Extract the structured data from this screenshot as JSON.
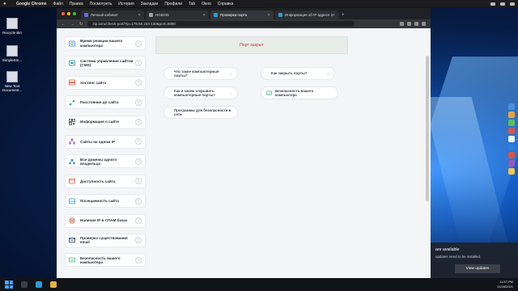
{
  "menubar": {
    "app": "Google Chrome",
    "items": [
      "Файл",
      "Правка",
      "Посмотреть",
      "История",
      "Закладки",
      "Профили",
      "Tab",
      "Окно",
      "Справка"
    ]
  },
  "desktop_icons": [
    "Recycle Bin",
    "SimpleSm...",
    "New Text Document..."
  ],
  "tabs": [
    {
      "label": "Личный кабинет",
      "active": false
    },
    {
      "label": "HG8245",
      "active": false
    },
    {
      "label": "Проверка порта",
      "active": true
    },
    {
      "label": "Информация об IP адресе 1",
      "active": false
    }
  ],
  "address_bar": "2ip.io/ru/check-port/?ip=178.66.243.130&port=8080",
  "sidebar": [
    {
      "label": "Время реакции вашего компьютера",
      "icon": "clock-icon"
    },
    {
      "label": "Система управления сайтом (CMS)",
      "icon": "cms-icon"
    },
    {
      "label": "Хостинг сайта",
      "icon": "server-icon"
    },
    {
      "label": "Расстояние до сайта",
      "icon": "distance-icon"
    },
    {
      "label": "Информация о сайте",
      "icon": "qr-icon"
    },
    {
      "label": "Сайты на одном IP",
      "icon": "sitemap-icon"
    },
    {
      "label": "Все домены одного владельца",
      "icon": "domains-icon"
    },
    {
      "label": "Доступность сайта",
      "icon": "window-icon"
    },
    {
      "label": "Посещаемость сайта",
      "icon": "stats-icon"
    },
    {
      "label": "Наличие IP в СПАМ базах",
      "icon": "block-icon"
    },
    {
      "label": "Проверка существования email",
      "icon": "email-icon"
    },
    {
      "label": "Безопасность вашего компьютера",
      "icon": "shield-icon"
    }
  ],
  "result_banner": "Порт закрыт",
  "links": [
    {
      "label": "Что такое компьютерные порты?"
    },
    {
      "label": "Как закрыть порты?"
    },
    {
      "label": "Как и зачем открывать компьютерные порты?"
    },
    {
      "label": "Безопасность вашего компьютера"
    },
    {
      "label": "Программы для безопасности в сети"
    }
  ],
  "notification": {
    "title": "are available",
    "body": "updates need to be installed.",
    "button": "View updates"
  },
  "tray": {
    "time": "11:57 PM",
    "date": "11/28/2021"
  },
  "colors": {
    "banner_text": "#c0392b",
    "icon_blue": "#2a7de1",
    "icon_green": "#38b37a",
    "icon_red": "#e0533d",
    "icon_purple": "#8e44ad"
  }
}
